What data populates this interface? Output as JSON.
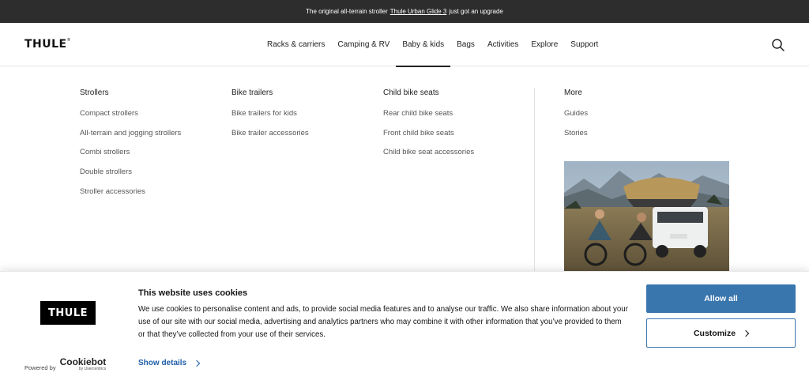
{
  "announcement": {
    "prefix": "The original all-terrain stroller",
    "link": "Thule Urban Glide 3",
    "suffix": "just got an upgrade"
  },
  "header": {
    "logo": "THULE",
    "nav": [
      "Racks & carriers",
      "Camping & RV",
      "Baby & kids",
      "Bags",
      "Activities",
      "Explore",
      "Support"
    ],
    "active_nav": "Baby & kids",
    "search_icon": "search-icon"
  },
  "menu": {
    "strollers": {
      "title": "Strollers",
      "links": [
        "Compact strollers",
        "All-terrain and jogging strollers",
        "Combi strollers",
        "Double strollers",
        "Stroller accessories"
      ]
    },
    "bike_trailers": {
      "title": "Bike trailers",
      "links": [
        "Bike trailers for kids",
        "Bike trailer accessories"
      ]
    },
    "child_bike_seats": {
      "title": "Child bike seats",
      "links": [
        "Rear child bike seats",
        "Front child bike seats",
        "Child bike seat accessories"
      ]
    },
    "more": {
      "title": "More",
      "links": [
        "Guides",
        "Stories"
      ]
    }
  },
  "cookie_banner": {
    "logo": "THULE",
    "title": "This website uses cookies",
    "text": "We use cookies to personalise content and ads, to provide social media features and to analyse our traffic. We also share information about your use of our site with our social media, advertising and analytics partners who may combine it with other information that you’ve provided to them or that they’ve collected from your use of their services.",
    "powered_by": "Powered by",
    "cookiebot": "Cookiebot",
    "usercentrics": "by Usercentrics",
    "show_details": "Show details",
    "allow_all": "Allow all",
    "customize": "Customize"
  },
  "colors": {
    "announcement_bg": "#2d2d2d",
    "primary_button": "#3a76ae",
    "link_blue": "#1f5ea8"
  }
}
